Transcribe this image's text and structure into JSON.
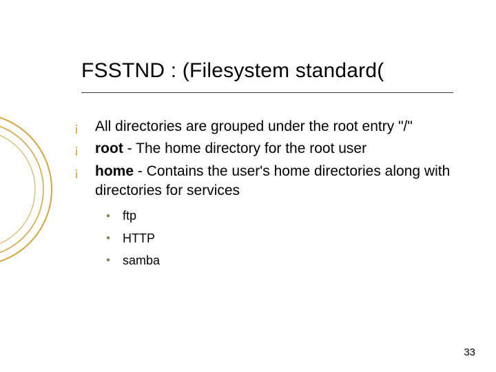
{
  "title": "FSSTND : (Filesystem standard(",
  "bullets": [
    {
      "pre": "",
      "bold": "",
      "post": "All directories are grouped under the root entry \"/\""
    },
    {
      "pre": "",
      "bold": "root",
      "post": " - The home directory for the root user"
    },
    {
      "pre": "",
      "bold": "home",
      "post": " - Contains the user's home directories along with directories for services"
    }
  ],
  "subbullets": [
    "ftp",
    "HTTP",
    "samba"
  ],
  "page_number": "33",
  "colors": {
    "accent_ring": "#d7a43a",
    "square_bullet": "#78863a"
  }
}
